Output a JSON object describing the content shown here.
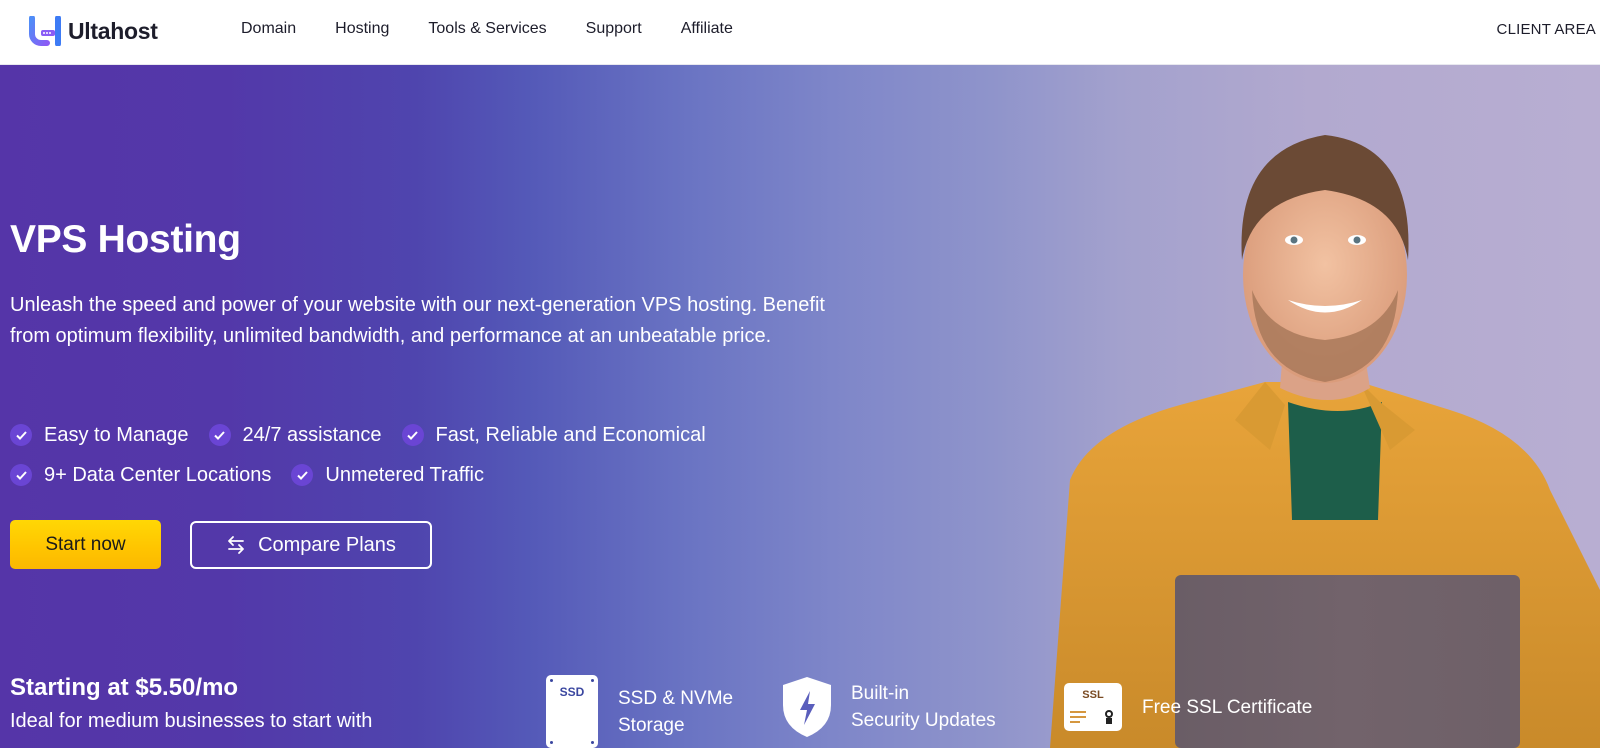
{
  "navbar": {
    "logo_text": "Ultahost",
    "links": [
      "Domain",
      "Hosting",
      "Tools & Services",
      "Support",
      "Affiliate"
    ],
    "client_area": "CLIENT AREA"
  },
  "hero": {
    "title": "VPS Hosting",
    "description": "Unleash the speed and power of your website with our next-generation VPS hosting. Benefit from optimum flexibility, unlimited bandwidth, and performance at an unbeatable price.",
    "features_row1": [
      "Easy to Manage",
      "24/7 assistance",
      "Fast, Reliable and Economical"
    ],
    "features_row2": [
      "9+ Data Center Locations",
      "Unmetered Traffic"
    ],
    "start_button": "Start now",
    "compare_button": "Compare Plans",
    "price_title": "Starting at $5.50/mo",
    "price_subtitle": "Ideal for medium businesses to start with",
    "benefits": [
      {
        "icon": "ssd-icon",
        "icon_text": "SSD",
        "line1": "SSD & NVMe",
        "line2": "Storage"
      },
      {
        "icon": "shield-bolt-icon",
        "line1": "Built-in",
        "line2": "Security Updates"
      },
      {
        "icon": "ssl-certificate-icon",
        "icon_text": "SSL",
        "line1": "Free SSL Certificate"
      }
    ],
    "person_image_alt": "Smiling man holding a laptop"
  },
  "colors": {
    "brand_purple": "#5535a8",
    "check_purple": "#6a45d4",
    "cta_yellow": "#ffc400",
    "logo_blue": "#3d7bf5"
  }
}
